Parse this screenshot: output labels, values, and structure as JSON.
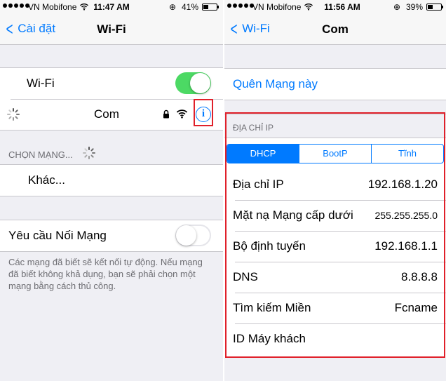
{
  "left": {
    "status": {
      "carrier": "VN Mobifone",
      "time": "11:47 AM",
      "battery": "41%",
      "battery_level": 0.41
    },
    "nav": {
      "back_label": "Cài đặt",
      "title": "Wi-Fi"
    },
    "wifi_row_label": "Wi-Fi",
    "wifi_enabled": true,
    "connected_network": "Com",
    "choose_network_header": "CHỌN MẠNG...",
    "other_label": "Khác...",
    "ask_to_join_label": "Yêu cầu Nối Mạng",
    "ask_to_join_enabled": false,
    "footer": "Các mạng đã biết sẽ kết nối tự động. Nếu mạng đã biết không khả dụng, bạn sẽ phải chọn một mạng bằng cách thủ công."
  },
  "right": {
    "status": {
      "carrier": "VN Mobifone",
      "time": "11:56 AM",
      "battery": "39%",
      "battery_level": 0.39
    },
    "nav": {
      "back_label": "Wi-Fi",
      "title": "Com"
    },
    "forget_label": "Quên Mạng này",
    "ip_header": "ĐỊA CHỈ IP",
    "segments": [
      "DHCP",
      "BootP",
      "Tĩnh"
    ],
    "selected_segment": "DHCP",
    "rows": [
      {
        "label": "Địa chỉ IP",
        "value": "192.168.1.20"
      },
      {
        "label": "Mặt nạ Mạng cấp dưới",
        "value": "255.255.255.0"
      },
      {
        "label": "Bộ định tuyến",
        "value": "192.168.1.1"
      },
      {
        "label": "DNS",
        "value": "8.8.8.8"
      },
      {
        "label": "Tìm kiếm Miền",
        "value": "Fcname"
      },
      {
        "label": "ID Máy khách",
        "value": ""
      }
    ]
  },
  "colors": {
    "accent": "#007aff",
    "toggle_on": "#4cd964",
    "highlight": "#e0202a"
  }
}
